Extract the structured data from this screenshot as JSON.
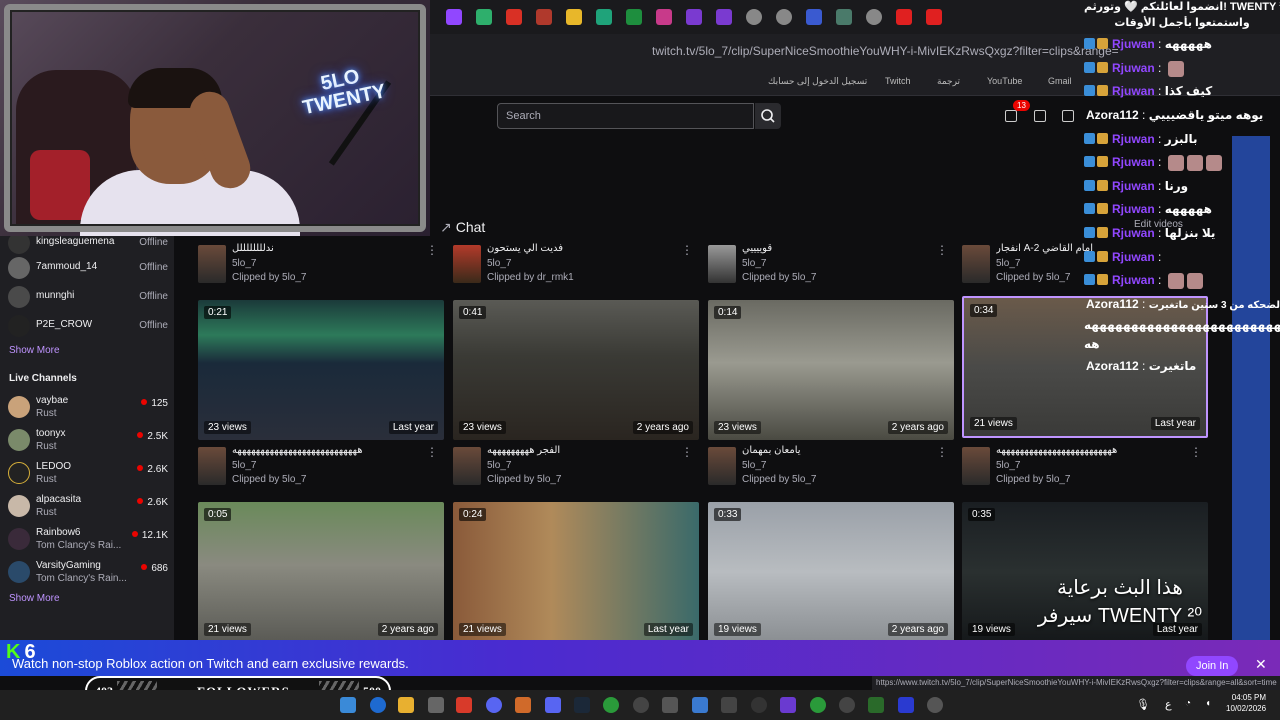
{
  "browser": {
    "url": "twitch.tv/5lo_7/clip/SuperNiceSmoothieYouWHY-i-MivIEKzRwsQxgz?filter=clips&range=",
    "bookmarks": [
      "تسجيل الدخول إلى حسابك",
      "Twitch",
      "ترجمة",
      "YouTube",
      "Gmail"
    ]
  },
  "header": {
    "search_placeholder": "Search",
    "notification_count": "13"
  },
  "webcam": {
    "neon_line1": "5LO",
    "neon_line2": "TWENTY"
  },
  "sidebar": {
    "followed": [
      {
        "name": "kingsleaguemena",
        "status": "Offline"
      },
      {
        "name": "7ammoud_14",
        "status": "Offline"
      },
      {
        "name": "munnghi",
        "status": "Offline"
      },
      {
        "name": "P2E_CROW",
        "status": "Offline"
      }
    ],
    "show_more_1": "Show More",
    "live_heading": "Live Channels",
    "live": [
      {
        "name": "vaybae",
        "game": "Rust",
        "viewers": "125"
      },
      {
        "name": "toonyx",
        "game": "Rust",
        "viewers": "2.5K"
      },
      {
        "name": "LEDOO",
        "game": "Rust",
        "viewers": "2.6K"
      },
      {
        "name": "alpacasita",
        "game": "Rust",
        "viewers": "2.6K"
      },
      {
        "name": "Rainbow6",
        "game": "Tom Clancy's Rai...",
        "viewers": "12.1K"
      },
      {
        "name": "VarsityGaming",
        "game": "Tom Clancy's Rain...",
        "viewers": "686"
      }
    ],
    "show_more_2": "Show More"
  },
  "main": {
    "chat_link": "Chat",
    "edit_videos": "Edit videos",
    "row1_meta": [
      {
        "title": "ندللللللللل",
        "channel": "5lo_7",
        "by": "Clipped by 5lo_7"
      },
      {
        "title": "فديت الي يستحون",
        "channel": "5lo_7",
        "by": "Clipped by dr_rmk1"
      },
      {
        "title": "قوييييي",
        "channel": "5lo_7",
        "by": "Clipped by 5lo_7"
      },
      {
        "title": "انفجار A-2 امام القاضي",
        "channel": "5lo_7",
        "by": "Clipped by 5lo_7"
      }
    ],
    "row2_clips": [
      {
        "duration": "0:21",
        "views": "23 views",
        "age": "Last year"
      },
      {
        "duration": "0:41",
        "views": "23 views",
        "age": "2 years ago"
      },
      {
        "duration": "0:14",
        "views": "23 views",
        "age": "2 years ago"
      },
      {
        "duration": "0:34",
        "views": "21 views",
        "age": "Last year"
      }
    ],
    "row2_meta": [
      {
        "title": "هههههههههههههههههههههههههههه",
        "channel": "5lo_7",
        "by": "Clipped by 5lo_7"
      },
      {
        "title": "الفجر هههههههههه",
        "channel": "5lo_7",
        "by": "Clipped by 5lo_7"
      },
      {
        "title": "يامعان بمهمان",
        "channel": "5lo_7",
        "by": "Clipped by 5lo_7"
      },
      {
        "title": "هههههههههههههههههههههههههه",
        "channel": "5lo_7",
        "by": "Clipped by 5lo_7"
      }
    ],
    "row3_clips": [
      {
        "duration": "0:05",
        "views": "21 views",
        "age": "2 years ago"
      },
      {
        "duration": "0:24",
        "views": "21 views",
        "age": "Last year"
      },
      {
        "duration": "0:33",
        "views": "19 views",
        "age": "2 years ago"
      },
      {
        "duration": "0:35",
        "views": "19 views",
        "age": "Last year"
      }
    ]
  },
  "chat": {
    "top_line": "انضموا لعائلتكم 🤍 وتورثم! TWENTY ²⁰",
    "top_line2": "واستمتعوا بأجمل الأوقات",
    "messages": [
      {
        "user": "Rjuwan",
        "text": "هههههه"
      },
      {
        "user": "Rjuwan",
        "text": ""
      },
      {
        "user": "Rjuwan",
        "text": "كيف كذا"
      },
      {
        "user": "Azora112",
        "text": "يوهه ميتو ياقضيييي"
      },
      {
        "user": "Rjuwan",
        "text": "بالبزر"
      },
      {
        "user": "Rjuwan",
        "text": ""
      },
      {
        "user": "Rjuwan",
        "text": "ورنا"
      },
      {
        "user": "Rjuwan",
        "text": "هههههه"
      },
      {
        "user": "Rjuwan",
        "text": "يلا بنزلها"
      },
      {
        "user": "Rjuwan",
        "text": ""
      },
      {
        "user": "Rjuwan",
        "text": ""
      }
    ],
    "long_msg_user": "Azora112",
    "long_msg_text": "الضحكه من 3 سنين ماتغيرت",
    "long_msg_text2": "هههههههههههههههههههههههههه",
    "long_msg_text3": "هه",
    "last_msg_user": "Azora112",
    "last_msg_text": "ماتغيرت"
  },
  "sponsor": {
    "line1": "هذا البث برعاية",
    "line2": "سيرفر TWENTY ²⁰"
  },
  "promo": {
    "text": "Watch non-stop Roblox action on Twitch and earn exclusive rewards.",
    "join": "Join In",
    "close": "✕",
    "kick_num": "6",
    "status_url": "https://www.twitch.tv/5lo_7/clip/SuperNiceSmoothieYouWHY-i-MivIEKzRwsQxgz?filter=clips&range=all&sort=time"
  },
  "followers": {
    "current": "403",
    "label": "FOLLOWERS",
    "goal": "500"
  },
  "taskbar": {
    "time": "04:05 PM",
    "date": "10/02/2026",
    "lang": "ع"
  }
}
